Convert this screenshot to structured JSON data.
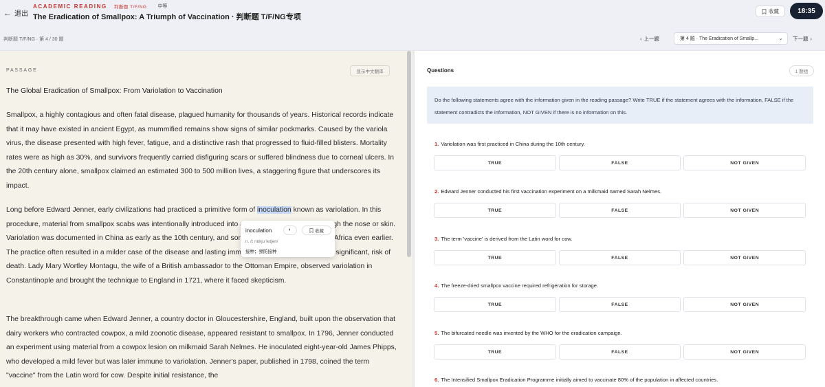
{
  "header": {
    "exit_label": "退出",
    "kicker": "ACADEMIC READING",
    "tag": "判断题 T/F/NG",
    "level": "中等",
    "title": "The Eradication of Smallpox: A Triumph of Vaccination · 判断题 T/F/NG专项",
    "favorite_label": "收藏",
    "timer": "18:35"
  },
  "subbar": {
    "progress": "判断题 T/F/NG · 第 4 / 30 题",
    "prev_label": "上一题",
    "question_select": "第 4 题 · The Eradication of Smallp...",
    "next_label": "下一题"
  },
  "passage": {
    "section_label": "PASSAGE",
    "show_chinese": "显示中文翻译",
    "title": "The Global Eradication of Smallpox: From Variolation to Vaccination",
    "para1": "Smallpox, a highly contagious and often fatal disease, plagued humanity for thousands of years. Historical records indicate that it may have existed in ancient Egypt, as mummified remains show signs of similar pockmarks. Caused by the variola virus, the disease presented with high fever, fatigue, and a distinctive rash that progressed to fluid-filled blisters. Mortality rates were as high as 30%, and survivors frequently carried disfiguring scars or suffered blindness due to corneal ulcers. In the 20th century alone, smallpox claimed an estimated 300 to 500 million lives, a staggering figure that underscores its impact.",
    "para2_before": "Long before Edward Jenner, early civilizations had practiced a primitive form of ",
    "para2_highlight": "inoculation",
    "para2_after": " known as variolation. In this procedure, material from smallpox scabs was intentionally introduced into a healthy person, either through the nose or skin. Variolation was documented in China as early as the 10th century, and some sources suggest its use in Africa even earlier. The practice often resulted in a milder case of the disease and lasting immunity with a lower, though still significant, risk of death. Lady Mary Wortley Montagu, the wife of a British ambassador to the Ottoman Empire, observed variolation in Constantinople and brought the technique to England in 1721, where it faced skepticism.",
    "para3": "The breakthrough came when Edward Jenner, a country doctor in Gloucestershire, England, built upon the observation that dairy workers who contracted cowpox, a mild zoonotic disease, appeared resistant to smallpox. In 1796, Jenner conducted an experiment using material from a cowpox lesion on milkmaid Sarah Nelmes. He inoculated eight-year-old James Phipps, who developed a mild fever but was later immune to variolation. Jenner's paper, published in 1798, coined the term \"vaccine\" from the Latin word for cow. Despite initial resistance, the"
  },
  "popup": {
    "word": "inoculation",
    "favorite_label": "收藏",
    "phonetic": "n. /ɪˌnɒkjuˈleɪʃən/",
    "definition": "接种；预防接种"
  },
  "questions": {
    "heading": "Questions",
    "count": "1 题组",
    "instructions": "Do the following statements agree with the information given in the reading passage? Write TRUE if the statement agrees with the information, FALSE if the statement contradicts the information, NOT GIVEN if there is no information on this.",
    "items": [
      {
        "num": "1.",
        "text": "Variolation was first practiced in China during the 10th century."
      },
      {
        "num": "2.",
        "text": "Edward Jenner conducted his first vaccination experiment on a milkmaid named Sarah Nelmes."
      },
      {
        "num": "3.",
        "text": "The term 'vaccine' is derived from the Latin word for cow."
      },
      {
        "num": "4.",
        "text": "The freeze-dried smallpox vaccine required refrigeration for storage."
      },
      {
        "num": "5.",
        "text": "The bifurcated needle was invented by the WHO for the eradication campaign."
      },
      {
        "num": "6.",
        "text": "The Intensified Smallpox Eradication Programme initially aimed to vaccinate 80% of the population in affected countries."
      }
    ],
    "options": [
      "TRUE",
      "FALSE",
      "NOT GIVEN"
    ]
  },
  "icons": {
    "back": "arrow-left-icon",
    "bookmark": "bookmark-icon",
    "speaker": "speaker-icon",
    "chevron": "chevron-down-icon"
  }
}
